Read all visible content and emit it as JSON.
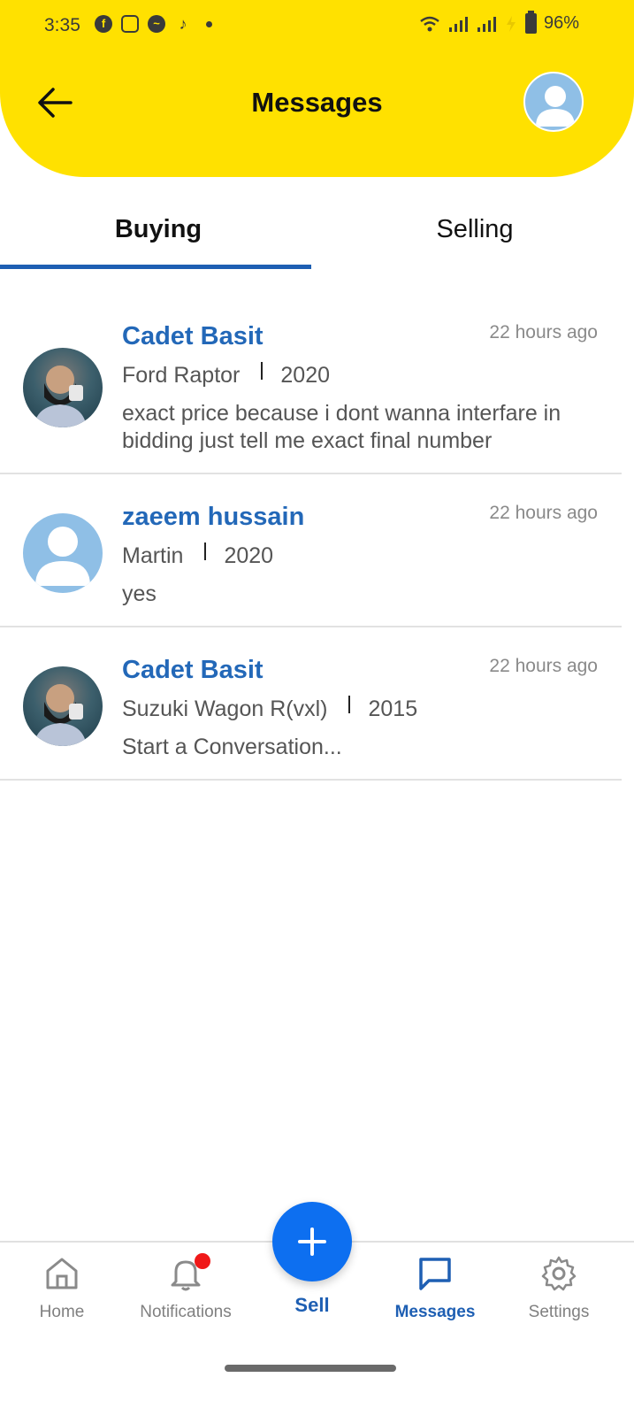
{
  "status_bar": {
    "time": "3:35",
    "battery": "96%",
    "app_icons": [
      "facebook-icon",
      "instagram-icon",
      "messenger-icon",
      "tiktok-icon"
    ]
  },
  "header": {
    "title": "Messages",
    "background_color": "#ffe100"
  },
  "tabs": [
    {
      "label": "Buying",
      "active": true
    },
    {
      "label": "Selling",
      "active": false
    }
  ],
  "conversations": [
    {
      "name": "Cadet Basit",
      "time": "22 hours ago",
      "vehicle": "Ford Raptor",
      "year": "2020",
      "message": "exact price because i dont wanna interfare in bidding just tell me exact final number",
      "avatar": "photo"
    },
    {
      "name": "zaeem hussain",
      "time": "22 hours ago",
      "vehicle": "Martin",
      "year": "2020",
      "message": "yes",
      "avatar": "placeholder"
    },
    {
      "name": "Cadet Basit",
      "time": "22 hours ago",
      "vehicle": "Suzuki Wagon R(vxl)",
      "year": "2015",
      "message": "Start a Conversation...",
      "avatar": "photo"
    }
  ],
  "bottom_nav": {
    "home": "Home",
    "notifications": "Notifications",
    "sell": "Sell",
    "messages": "Messages",
    "settings": "Settings",
    "active": "Messages",
    "accent_color": "#1e5fb3"
  }
}
